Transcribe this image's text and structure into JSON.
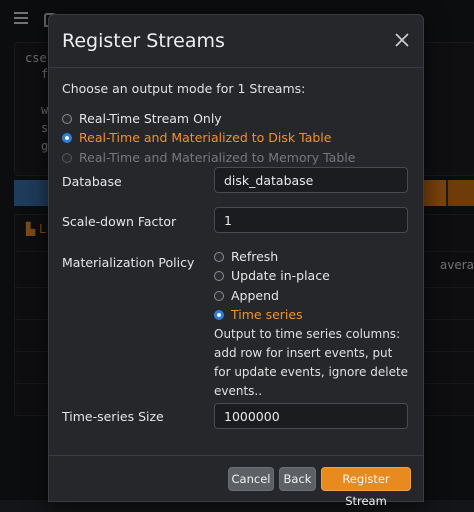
{
  "background": {
    "code_lines": [
      "csel",
      "f",
      "w",
      "s",
      "g"
    ],
    "chart_tab_label": "L",
    "column_header": "avera",
    "colors": {
      "accent_orange": "#e07b16",
      "accent_blue": "#3a6ea8"
    }
  },
  "modal": {
    "title": "Register Streams",
    "intro": "Choose an output mode for 1 Streams:",
    "output_modes": [
      {
        "label": "Real-Time Stream Only",
        "state": "unchecked"
      },
      {
        "label": "Real-Time and Materialized to Disk Table",
        "state": "checked"
      },
      {
        "label": "Real-Time and Materialized to Memory Table",
        "state": "disabled"
      }
    ],
    "database": {
      "label": "Database",
      "value": "disk_database"
    },
    "scale_down": {
      "label": "Scale-down Factor",
      "value": "1"
    },
    "policy": {
      "label": "Materialization Policy",
      "options": [
        {
          "label": "Refresh",
          "state": "unchecked"
        },
        {
          "label": "Update in-place",
          "state": "unchecked"
        },
        {
          "label": "Append",
          "state": "unchecked"
        },
        {
          "label": "Time series",
          "state": "checked"
        }
      ],
      "description": "Output to time series columns: add row for insert events, put for update events, ignore delete events.."
    },
    "timeseries_size": {
      "label": "Time-series Size",
      "value": "1000000"
    },
    "buttons": {
      "cancel": "Cancel",
      "back": "Back",
      "register": "Register Stream"
    },
    "colors": {
      "selected_text": "#f0932b",
      "radio_checked": "#2f7fd9",
      "primary_button": "#e88a1d"
    }
  }
}
